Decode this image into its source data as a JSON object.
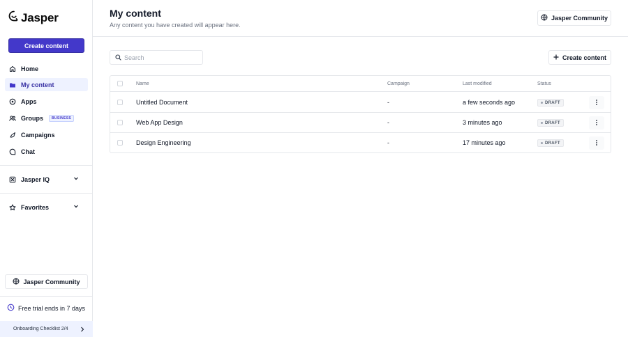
{
  "sidebar": {
    "logo_text": "Jasper",
    "create_button": "Create content",
    "nav": {
      "home": "Home",
      "my_content": "My content",
      "apps": "Apps",
      "groups": "Groups",
      "groups_badge": "BUSINESS",
      "campaigns": "Campaigns",
      "chat": "Chat"
    },
    "jasper_iq": "Jasper IQ",
    "favorites": "Favorites",
    "community": "Jasper Community",
    "trial": "Free trial ends in 7 days",
    "onboarding": "Onboarding Checklist 2/4"
  },
  "header": {
    "title": "My content",
    "subtitle": "Any content you have created will appear here.",
    "community_button": "Jasper Community"
  },
  "toolbar": {
    "search_placeholder": "Search",
    "create_button": "Create content"
  },
  "table": {
    "columns": [
      "Name",
      "Campaign",
      "Last modified",
      "Status"
    ],
    "rows": [
      {
        "name": "Untitled Document",
        "campaign": "-",
        "modified": "a few seconds ago",
        "status": "DRAFT"
      },
      {
        "name": "Web App Design",
        "campaign": "-",
        "modified": "3 minutes ago",
        "status": "DRAFT"
      },
      {
        "name": "Design Engineering",
        "campaign": "-",
        "modified": "17 minutes ago",
        "status": "DRAFT"
      }
    ]
  },
  "colors": {
    "accent": "#4338ca",
    "active_bg": "#eef2ff"
  }
}
